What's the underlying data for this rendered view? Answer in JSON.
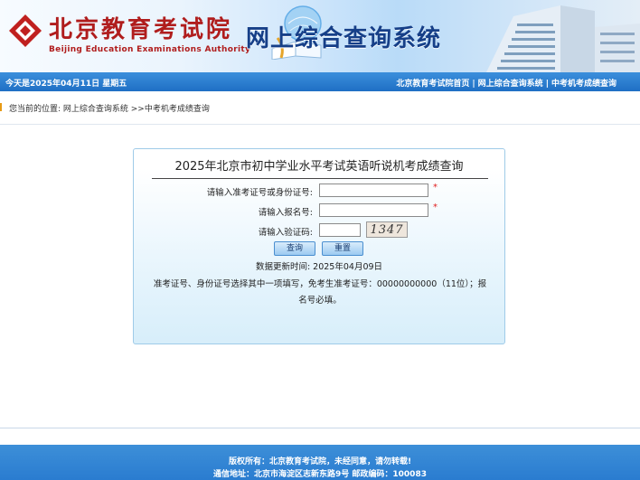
{
  "header": {
    "org_name_cn": "北京教育考试院",
    "org_name_en": "Beijing Education Examinations Authority",
    "system_title": "网上综合查询系统"
  },
  "navbar": {
    "date_text": "今天是2025年04月11日  星期五",
    "links": [
      "北京教育考试院首页",
      "网上综合查询系统",
      "中考机考成绩查询"
    ],
    "separator": "|"
  },
  "breadcrumb": {
    "text": "您当前的位置:   网上综合查询系统 >>中考机考成绩查询"
  },
  "form": {
    "title": "2025年北京市初中学业水平考试英语听说机考成绩查询",
    "id_label": "请输入准考证号或身份证号:",
    "id_value": "",
    "reg_label": "请输入报名号:",
    "reg_value": "",
    "captcha_label": "请输入验证码:",
    "captcha_value": "",
    "captcha_text": "1347",
    "required_mark": "*",
    "query_button": "查询",
    "reset_button": "重置",
    "update_text": "数据更新时间:   2025年04月09日",
    "note_text": "准考证号、身份证号选择其中一项填写，免考生准考证号：00000000000（11位）；报名号必填。"
  },
  "footer": {
    "copyright": "版权所有：北京教育考试院，未经同意，请勿转载!",
    "address": "通信地址：北京市海淀区志新东路9号 邮政编码：100083"
  },
  "colors": {
    "brand_red": "#b01d1d",
    "title_blue": "#163f88",
    "bar_blue": "#1f6fc4",
    "required_red": "#e02020"
  }
}
